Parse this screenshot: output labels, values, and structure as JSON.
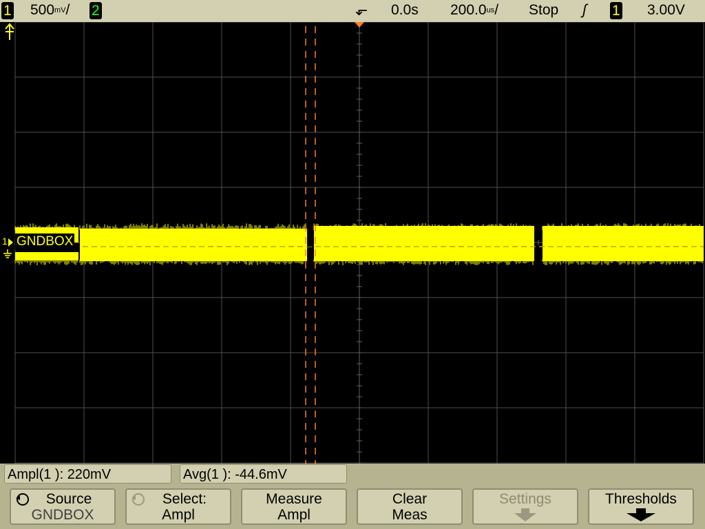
{
  "status": {
    "ch1_num": "1",
    "ch1_scale": "500",
    "ch1_unit": "mV",
    "ch2_num": "2",
    "time_delay": "0.0s",
    "time_scale": "200.0",
    "time_unit": "us",
    "run_state": "Stop",
    "trig_source": "1",
    "trig_level": "3.00V"
  },
  "channel": {
    "marker_num": "1",
    "label": "GNDBOX"
  },
  "measurements": [
    {
      "label": "Ampl(1 ):",
      "value": "220mV"
    },
    {
      "label": "Avg(1 ):",
      "value": "-44.6mV"
    }
  ],
  "softkeys": [
    {
      "line1": "Source",
      "line2": "GNDBOX",
      "enabled": true
    },
    {
      "line1": "Select:",
      "line2": "Ampl",
      "enabled": true
    },
    {
      "line1": "Measure",
      "line2": "Ampl",
      "enabled": true
    },
    {
      "line1": "Clear",
      "line2": "Meas",
      "enabled": true
    },
    {
      "line1": "Settings",
      "line2": "",
      "enabled": false
    },
    {
      "line1": "Thresholds",
      "line2": "",
      "enabled": true
    }
  ],
  "colors": {
    "ch1": "#ffff00",
    "ch2": "#00ff00",
    "grid": "#505050",
    "cursor": "#ff8020",
    "panel": "#d2d0b0"
  }
}
